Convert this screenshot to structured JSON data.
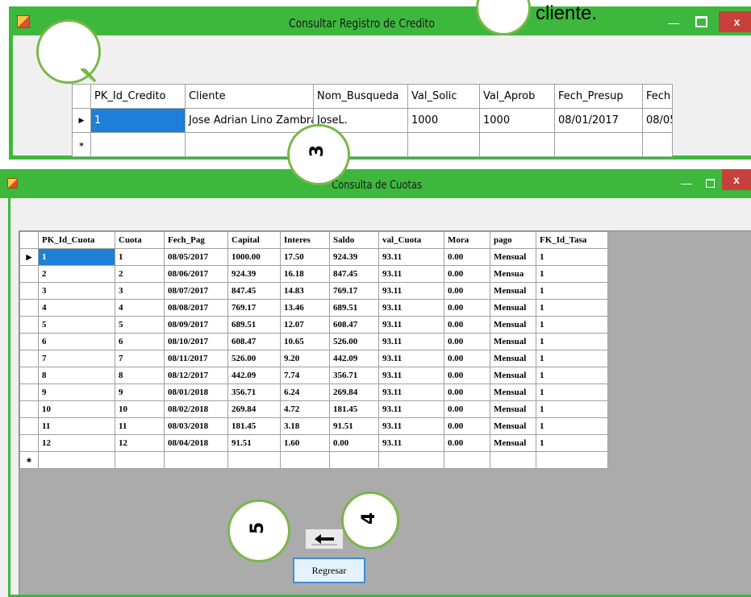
{
  "window1": {
    "title": "Consultar Registro de Credito",
    "grid": {
      "columns": [
        "PK_Id_Credito",
        "Cliente",
        "Nom_Busqueda",
        "Val_Solic",
        "Val_Aprob",
        "Fech_Presup",
        "Fech"
      ],
      "rows": [
        [
          "1",
          "Jose Adrian Lino Zambrano",
          "JoseL.",
          "1000",
          "1000",
          "08/01/2017",
          "08/05"
        ]
      ]
    }
  },
  "overlay_text": {
    "cliente": "cliente."
  },
  "callouts": {
    "c1": "",
    "c2": "",
    "c3": "3",
    "c4": "4",
    "c5": "5"
  },
  "window2": {
    "title": "Consulta de Cuotas",
    "grid": {
      "columns": [
        "PK_Id_Cuota",
        "Cuota",
        "Fech_Pag",
        "Capital",
        "Interes",
        "Saldo",
        "val_Cuota",
        "Mora",
        "pago",
        "FK_Id_Tasa"
      ],
      "rows": [
        [
          "1",
          "1",
          "08/05/2017",
          "1000.00",
          "17.50",
          "924.39",
          "93.11",
          "0.00",
          "Mensual",
          "1"
        ],
        [
          "2",
          "2",
          "08/06/2017",
          "924.39",
          "16.18",
          "847.45",
          "93.11",
          "0.00",
          "Mensua",
          "1"
        ],
        [
          "3",
          "3",
          "08/07/2017",
          "847.45",
          "14.83",
          "769.17",
          "93.11",
          "0.00",
          "Mensual",
          "1"
        ],
        [
          "4",
          "4",
          "08/08/2017",
          "769.17",
          "13.46",
          "689.51",
          "93.11",
          "0.00",
          "Mensual",
          "1"
        ],
        [
          "5",
          "5",
          "08/09/2017",
          "689.51",
          "12.07",
          "608.47",
          "93.11",
          "0.00",
          "Mensual",
          "1"
        ],
        [
          "6",
          "6",
          "08/10/2017",
          "608.47",
          "10.65",
          "526.00",
          "93.11",
          "0.00",
          "Mensual",
          "1"
        ],
        [
          "7",
          "7",
          "08/11/2017",
          "526.00",
          "9.20",
          "442.09",
          "93.11",
          "0.00",
          "Mensual",
          "1"
        ],
        [
          "8",
          "8",
          "08/12/2017",
          "442.09",
          "7.74",
          "356.71",
          "93.11",
          "0.00",
          "Mensual",
          "1"
        ],
        [
          "9",
          "9",
          "08/01/2018",
          "356.71",
          "6.24",
          "269.84",
          "93.11",
          "0.00",
          "Mensual",
          "1"
        ],
        [
          "10",
          "10",
          "08/02/2018",
          "269.84",
          "4.72",
          "181.45",
          "93.11",
          "0.00",
          "Mensual",
          "1"
        ],
        [
          "11",
          "11",
          "08/03/2018",
          "181.45",
          "3.18",
          "91.51",
          "93.11",
          "0.00",
          "Mensual",
          "1"
        ],
        [
          "12",
          "12",
          "08/04/2018",
          "91.51",
          "1.60",
          "0.00",
          "93.11",
          "0.00",
          "Mensual",
          "1"
        ]
      ]
    },
    "back_label": "Regresar"
  },
  "icons": {
    "app": "app-icon",
    "minimize": "minimize-icon",
    "maximize": "maximize-icon",
    "close": "close-icon",
    "back": "back-arrow-icon"
  }
}
